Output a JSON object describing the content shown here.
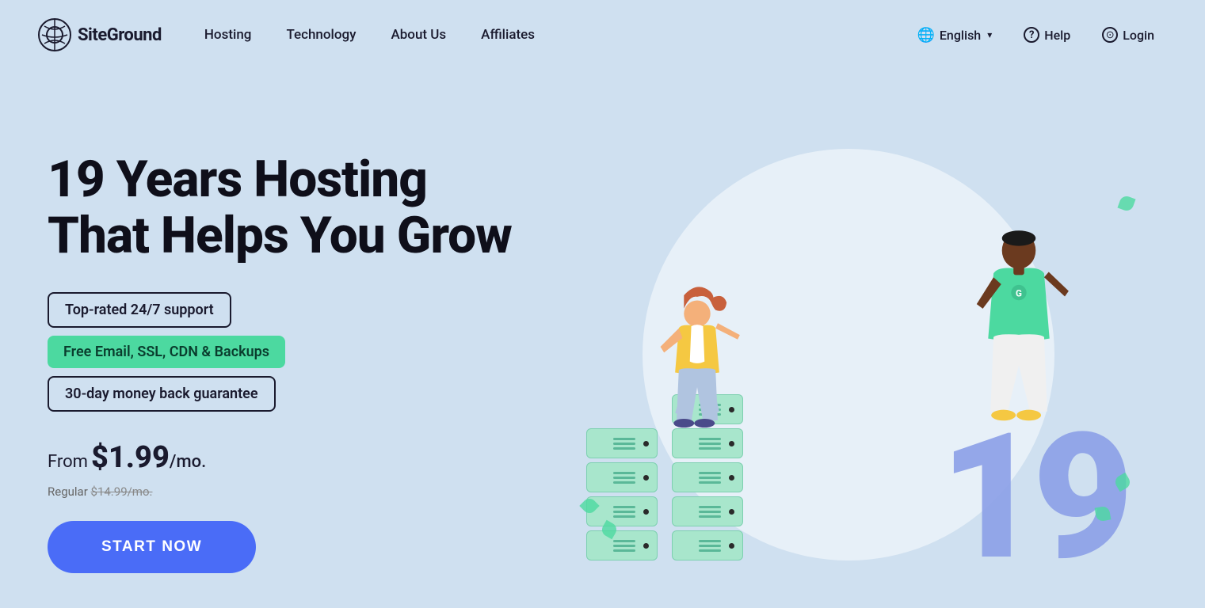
{
  "nav": {
    "logo_text": "SiteGround",
    "links": [
      {
        "label": "Hosting",
        "id": "hosting"
      },
      {
        "label": "Technology",
        "id": "technology"
      },
      {
        "label": "About Us",
        "id": "about"
      },
      {
        "label": "Affiliates",
        "id": "affiliates"
      }
    ],
    "right": {
      "language_label": "English",
      "help_label": "Help",
      "login_label": "Login"
    }
  },
  "hero": {
    "title_line1": "19 Years Hosting",
    "title_line2": "That Helps You Grow",
    "badges": [
      {
        "text": "Top-rated 24/7 support",
        "style": "outline"
      },
      {
        "text": "Free Email, SSL, CDN & Backups",
        "style": "green"
      },
      {
        "text": "30-day money back guarantee",
        "style": "outline"
      }
    ],
    "price_from": "From",
    "price_amount": "$1.99",
    "price_suffix": "/mo.",
    "price_regular_label": "Regular",
    "price_regular_old": "$14.99/mo.",
    "cta_label": "START NOW",
    "hero_number": "19"
  },
  "icons": {
    "translate_icon": "𝐴A",
    "help_icon": "?",
    "person_icon": "⊙",
    "chevron_down": "▾"
  },
  "colors": {
    "bg": "#cfe0f0",
    "nav_text": "#1a1a2e",
    "badge_green": "#4cd9a0",
    "cta_bg": "#4a6cf7",
    "number_color": "#8ca0e8",
    "server_color": "#a8e6cc"
  }
}
